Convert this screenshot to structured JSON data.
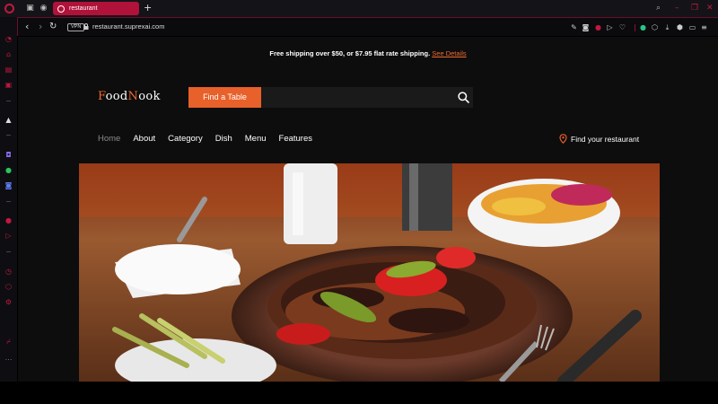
{
  "browser": {
    "tab_title": "restaurant",
    "new_tab_glyph": "+",
    "url": "restaurant.suprexai.com",
    "vpn_label": "VPN"
  },
  "banner": {
    "text": "Free shipping over $50, or $7.95 flat rate shipping.",
    "link": "See Details"
  },
  "logo": {
    "part1": "F",
    "part2": "ood",
    "part3": "N",
    "part4": "ook"
  },
  "search": {
    "button_label": "Find a Table",
    "value": "",
    "placeholder": ""
  },
  "nav": {
    "items": [
      "Home",
      "About",
      "Category",
      "Dish",
      "Menu",
      "Features"
    ],
    "active": "Home",
    "find_restaurant": "Find your restaurant"
  },
  "hero": {
    "icon": "food-plate-image"
  },
  "colors": {
    "accent": "#e8602a",
    "brand": "#b0123a"
  }
}
